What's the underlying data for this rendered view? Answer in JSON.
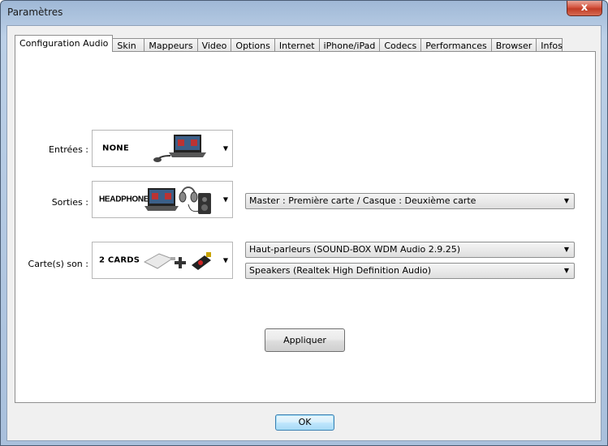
{
  "window": {
    "title": "Paramètres",
    "close_glyph": "x"
  },
  "tabs": [
    {
      "label": "Configuration Audio",
      "active": true
    },
    {
      "label": "Skin"
    },
    {
      "label": "Mappeurs"
    },
    {
      "label": "Video"
    },
    {
      "label": "Options"
    },
    {
      "label": "Internet"
    },
    {
      "label": "iPhone/iPad"
    },
    {
      "label": "Codecs"
    },
    {
      "label": "Performances"
    },
    {
      "label": "Browser"
    },
    {
      "label": "Infos"
    }
  ],
  "inputs": {
    "label": "Entrées :",
    "value": "NONE",
    "icon": "laptop-with-mixer-icon"
  },
  "outputs": {
    "label": "Sorties :",
    "value": "HEADPHONES",
    "icon": "laptop-headphones-speaker-icon",
    "mode_select": "Master : Première carte / Casque : Deuxième carte"
  },
  "soundcards": {
    "label": "Carte(s) son :",
    "value": "2 CARDS",
    "icon": "two-soundcards-icon",
    "card1_select": "Haut-parleurs (SOUND-BOX WDM Audio 2.9.25)",
    "card2_select": "Speakers (Realtek High Definition Audio)"
  },
  "buttons": {
    "apply": "Appliquer",
    "ok": "OK"
  },
  "colors": {
    "accent": "#3c7fb1",
    "close_red": "#c13c26"
  }
}
